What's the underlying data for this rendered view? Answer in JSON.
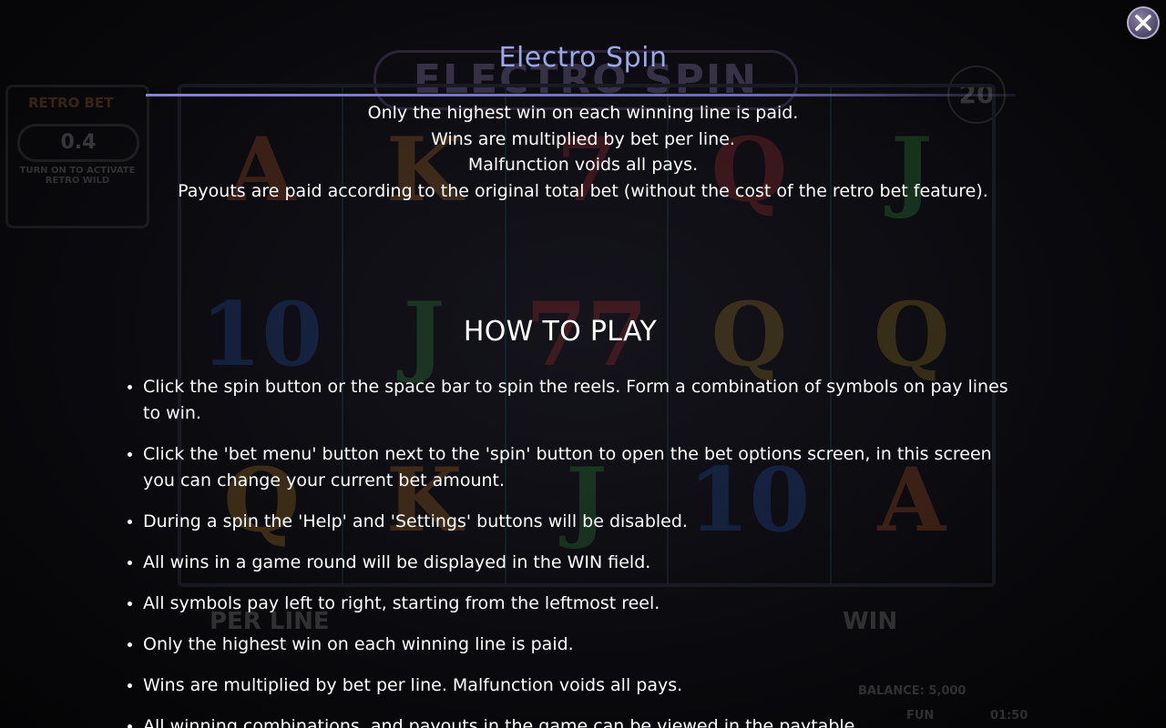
{
  "help": {
    "title": "Electro Spin",
    "close_icon": "close-icon",
    "intro_lines": [
      "Only the highest win on each winning line is paid.",
      "Wins are multiplied by bet per line.",
      "Malfunction voids all pays.",
      "Payouts are paid according to the original total bet (without the cost of the retro bet feature)."
    ],
    "how_to_play": {
      "heading": "HOW TO PLAY",
      "items": [
        "Click the spin button or the space bar to spin the reels. Form a combination of symbols on pay lines to win.",
        "Click the 'bet menu' button next to the 'spin' button to open the bet options screen, in this screen you can change your current bet amount.",
        "During a spin the 'Help' and 'Settings' buttons will be disabled.",
        "All wins in a game round will be displayed in the WIN field.",
        "All symbols pay left to right, starting from the leftmost reel.",
        "Only the highest win on each winning line is paid.",
        "Wins are multiplied by bet per line. Malfunction voids all pays.",
        "All winning combinations, and payouts in the game can be viewed in the paytable."
      ]
    }
  },
  "background_game": {
    "logo": "ELECTRO SPIN",
    "lines_badge": "20",
    "retro_bet": {
      "title": "RETRO BET",
      "value": "0.4",
      "hint": "TURN ON TO ACTIVATE RETRO WILD"
    },
    "reels": [
      [
        "A",
        "10",
        "Q"
      ],
      [
        "K",
        "J",
        "K"
      ],
      [
        "7",
        "77",
        "J"
      ],
      [
        "Q",
        "Q",
        "10"
      ],
      [
        "J",
        "Q",
        "A"
      ]
    ],
    "per_line_label": "PER LINE",
    "win_label": "WIN",
    "balance_text": "BALANCE: 5,000",
    "mode_text": "FUN",
    "clock_text": "01:50"
  },
  "colors": {
    "title": "#9aa8ea",
    "divider": "#8b82d8",
    "close_button": "#5e5878",
    "text": "#ffffff"
  }
}
